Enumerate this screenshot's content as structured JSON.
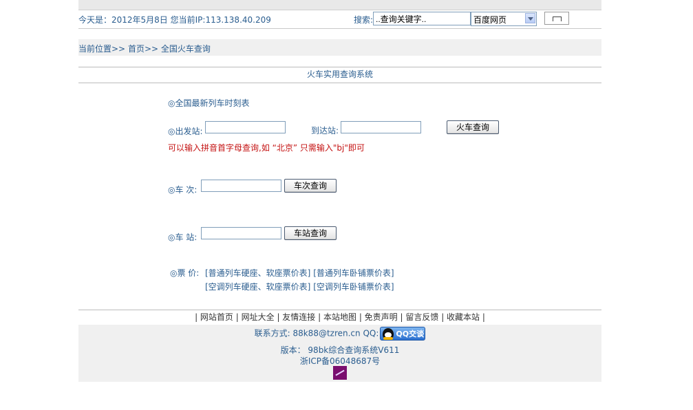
{
  "header": {
    "date_ip_text": "今天是：2012年5月8日   您当前IP:113.138.40.209",
    "search_label": "搜索:",
    "search_value": "..查询关键字..",
    "engine_selected": "百度网页"
  },
  "breadcrumb": {
    "prefix": "当前位置>> ",
    "home": "首页",
    "sep": ">> ",
    "current": "全国火车查询"
  },
  "main": {
    "system_title": "火车实用查询系统",
    "timetable_title": "◎全国最新列车时刻表",
    "depart_label": "◎出发站:",
    "arrive_label": "到达站:",
    "train_query_button": "火车查询",
    "hint": "可以输入拼音首字母查询,如 “北京” 只需输入\"bj\"即可",
    "train_no_label": "◎车 次:",
    "train_no_button": "车次查询",
    "station_label": "◎车 站:",
    "station_button": "车站查询",
    "price_label": "◎票 价:",
    "price_links": [
      "[普通列车硬座、软座票价表]",
      "[普通列车卧铺票价表]",
      "[空调列车硬座、软座票价表]",
      "[空调列车卧铺票价表]"
    ]
  },
  "footer": {
    "nav": [
      "网站首页",
      "网址大全",
      "友情连接",
      "本站地图",
      "免责声明",
      "留言反馈",
      "收藏本站"
    ],
    "contact": "联系方式: 88k88@tzren.cn QQ:",
    "qq_button": "QQ交谈",
    "version": "版本：  98bk综合查询系统V611",
    "icp": "浙ICP备06048687号"
  },
  "colors": {
    "link": "#2a5d8f",
    "hint": "#c41212",
    "panel_bg": "#f0f0f0"
  }
}
